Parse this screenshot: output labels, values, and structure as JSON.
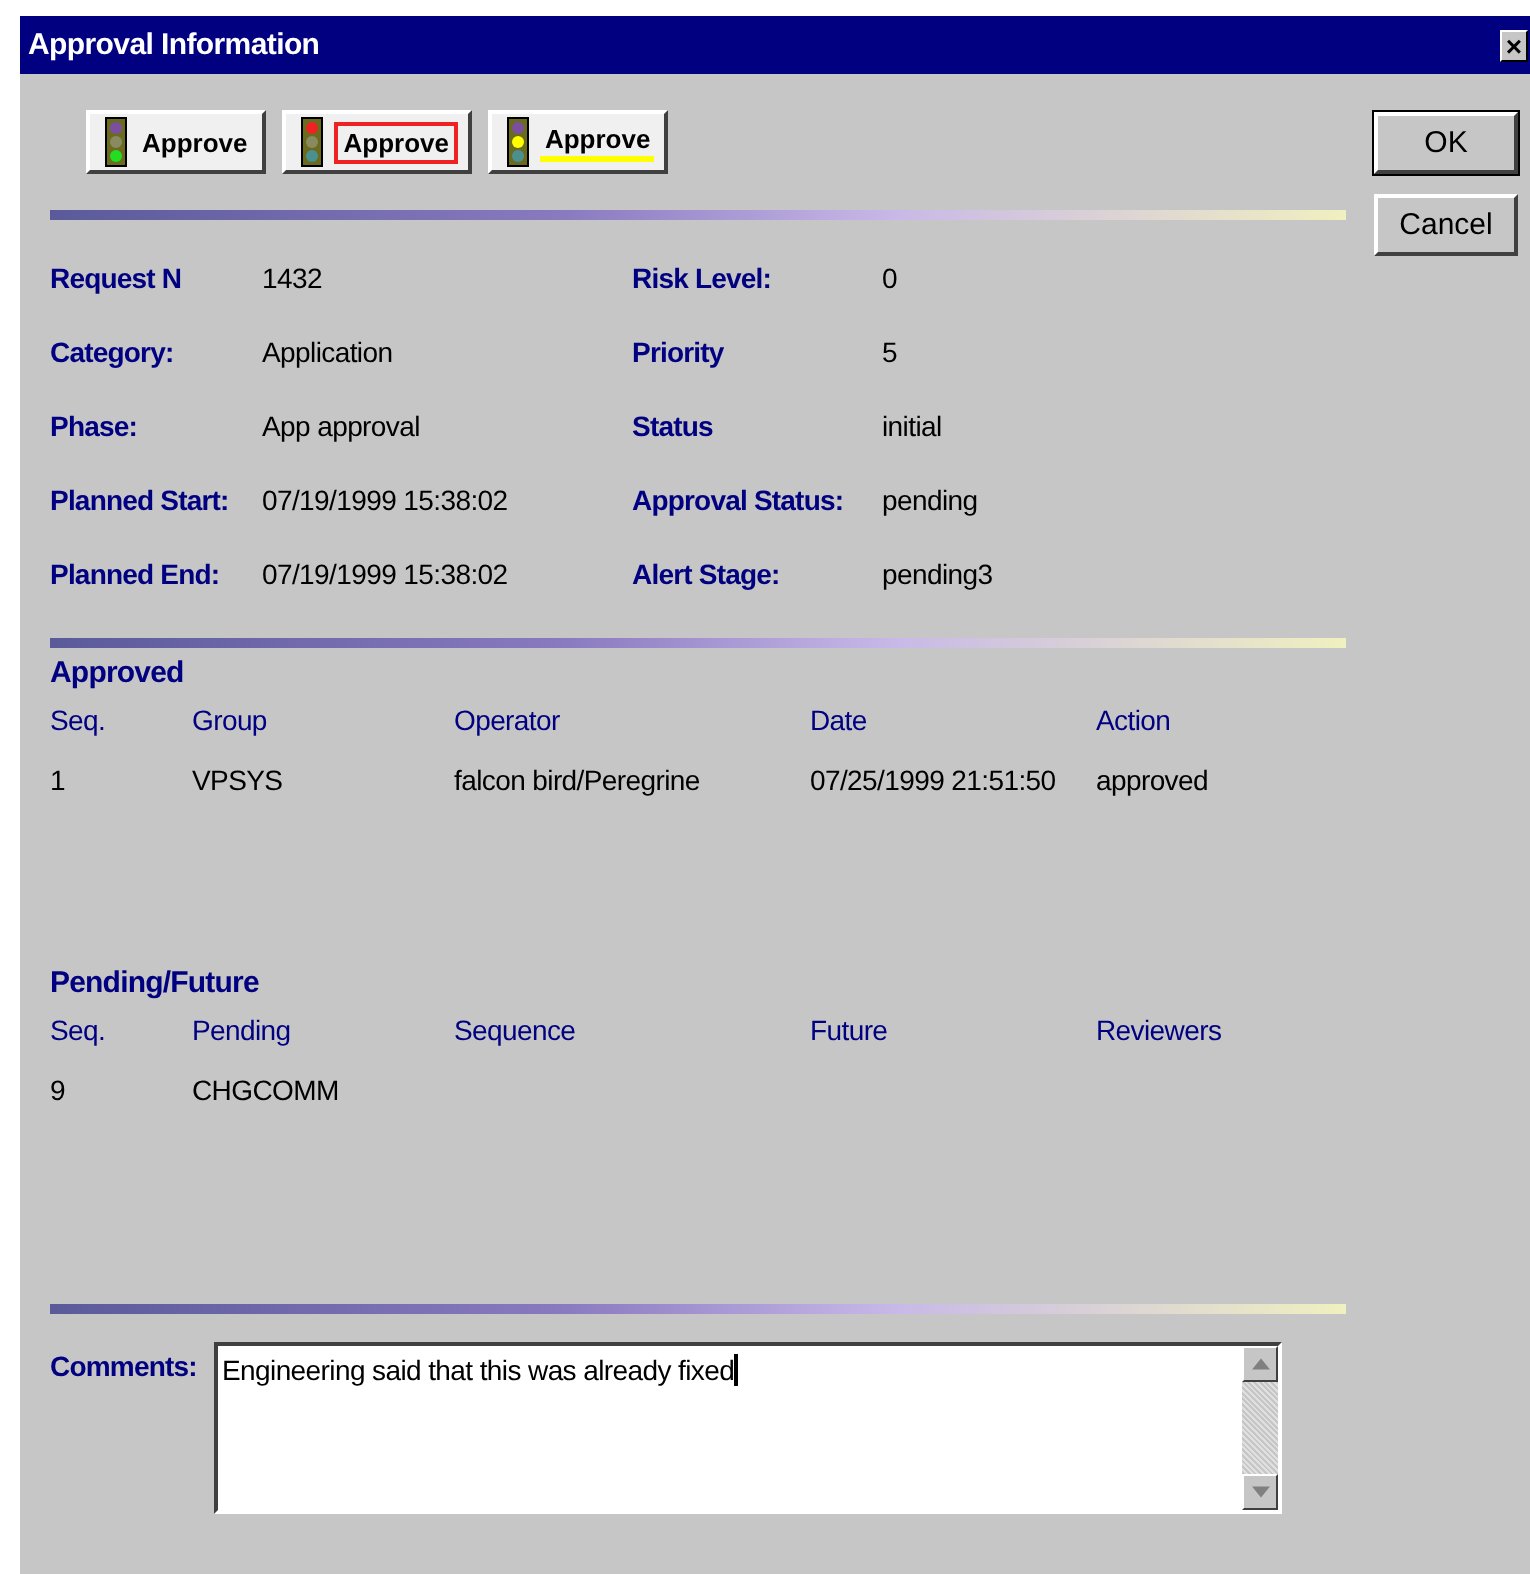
{
  "window": {
    "title": "Approval Information",
    "close": "×"
  },
  "toolbar": [
    {
      "label": "Approve",
      "kind": "green"
    },
    {
      "label": "Approve",
      "kind": "red"
    },
    {
      "label": "Approve",
      "kind": "yellow"
    }
  ],
  "dialog_buttons": [
    {
      "label": "OK",
      "default": true
    },
    {
      "label": "Cancel",
      "default": false
    }
  ],
  "details": [
    {
      "label": "Request N",
      "value": "1432",
      "label_2": "Risk Level:",
      "value_2": "0"
    },
    {
      "label": "Category:",
      "value": "Application",
      "label_2": "Priority",
      "value_2": "5"
    },
    {
      "label": "Phase:",
      "value": "App approval",
      "label_2": "Status",
      "value_2": "initial"
    },
    {
      "label": "Planned Start:",
      "value": "07/19/1999 15:38:02",
      "label_2": "Approval Status:",
      "value_2": "pending"
    },
    {
      "label": "Planned End:",
      "value": "07/19/1999 15:38:02",
      "label_2": "Alert Stage:",
      "value_2": "pending3"
    }
  ],
  "tables": [
    {
      "title": "Approved",
      "columns": [
        "Seq.",
        "Group",
        "Operator",
        "Date",
        "Action"
      ],
      "rows": [
        [
          "1",
          "VPSYS",
          "falcon bird/Peregrine",
          "07/25/1999 21:51:50",
          "approved"
        ]
      ]
    },
    {
      "title": "Pending/Future",
      "columns": [
        "Seq.",
        "Pending",
        "Sequence",
        "Future",
        "Reviewers"
      ],
      "rows": [
        [
          "9",
          "CHGCOMM"
        ]
      ]
    }
  ],
  "comments": {
    "label": "Comments:",
    "value": "Engineering said that this was already fixed"
  }
}
